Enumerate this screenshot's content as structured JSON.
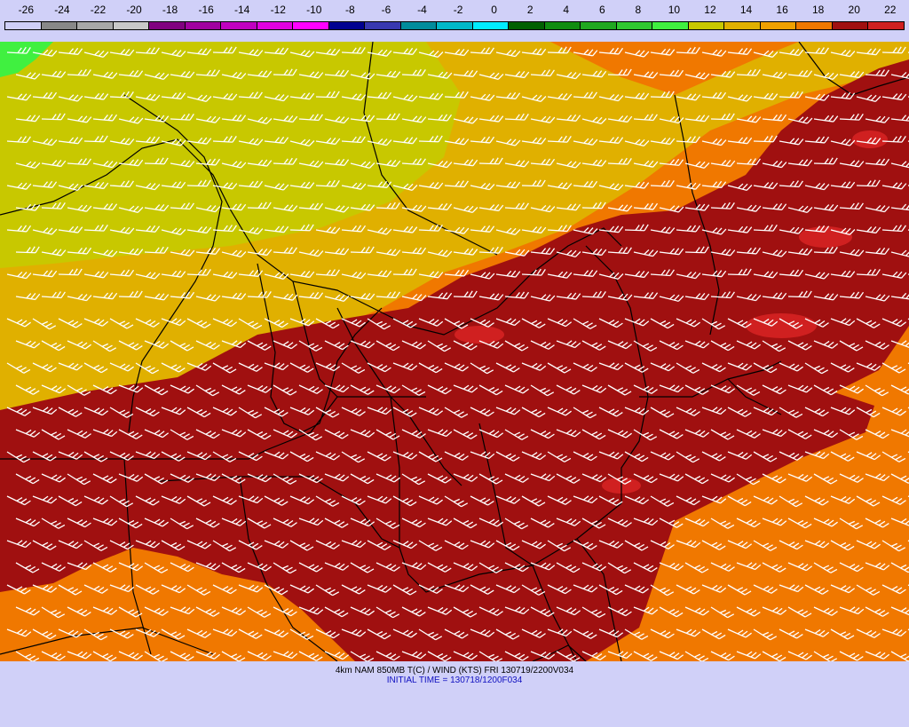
{
  "legend": {
    "ticks": [
      "-26",
      "-24",
      "-22",
      "-20",
      "-18",
      "-16",
      "-14",
      "-12",
      "-10",
      "-8",
      "-6",
      "-4",
      "-2",
      "0",
      "2",
      "4",
      "6",
      "8",
      "10",
      "12",
      "14",
      "16",
      "18",
      "20",
      "22"
    ],
    "colors": [
      "#d0d0f8",
      "#888888",
      "#a8a8a8",
      "#c8c8c8",
      "#800080",
      "#a000a0",
      "#c000c0",
      "#e000e0",
      "#ff00ff",
      "#000090",
      "#3838b0",
      "#008c9c",
      "#00b8c8",
      "#00ecff",
      "#006000",
      "#108c10",
      "#20a820",
      "#30c830",
      "#40f040",
      "#c8c800",
      "#e0b000",
      "#f0a000",
      "#f07800",
      "#a01010",
      "#d02020"
    ]
  },
  "map": {
    "fields": {
      "cold_region": "#c8c800",
      "cool_region": "#e0b000",
      "warm_region": "#f07800",
      "hot_region": "#a01010",
      "hottest_spots": "#d02020",
      "coldest_corner": "#40f040"
    },
    "boundary_color": "#000000",
    "barb_color": "#ffffff",
    "barb_direction": "west-northwest"
  },
  "caption": {
    "line1": "4km NAM 850MB T(C) / WIND (KTS) FRI 130719/2200V034",
    "line2": "INITIAL TIME = 130718/1200F034"
  }
}
